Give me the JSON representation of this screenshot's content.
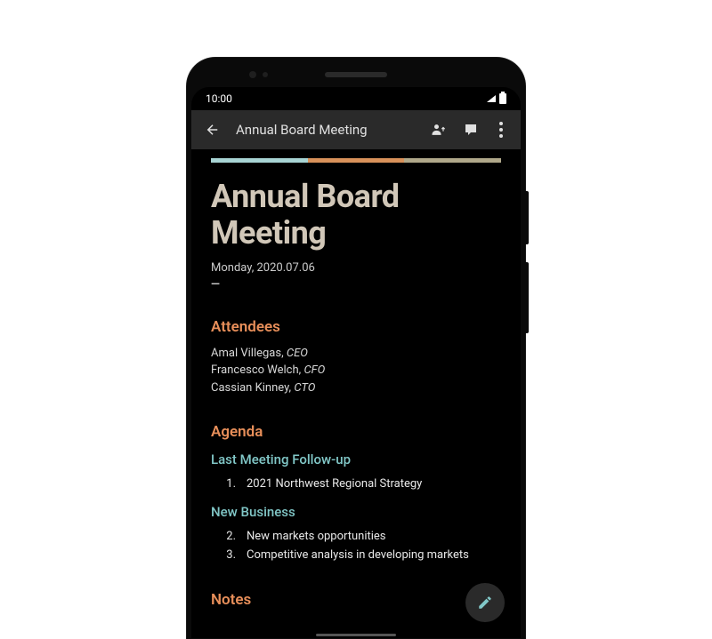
{
  "status_bar": {
    "time": "10:00"
  },
  "app_bar": {
    "title": "Annual Board Meeting"
  },
  "accent_colors": {
    "bar1": "#a8d4d4",
    "bar2": "#d8915a",
    "bar3": "#b0a88a"
  },
  "document": {
    "title": "Annual Board Meeting",
    "date": "Monday, 2020.07.06",
    "dash": "—"
  },
  "sections": {
    "attendees_header": "Attendees",
    "attendees": [
      {
        "name": "Amal Villegas",
        "title": "CEO"
      },
      {
        "name": "Francesco Welch",
        "title": "CFO"
      },
      {
        "name": "Cassian Kinney",
        "title": "CTO"
      }
    ],
    "agenda_header": "Agenda",
    "agenda_groups": [
      {
        "subheader": "Last Meeting Follow-up",
        "items": [
          {
            "num": "1.",
            "text": "2021 Northwest Regional Strategy"
          }
        ]
      },
      {
        "subheader": "New Business",
        "items": [
          {
            "num": "2.",
            "text": "New markets opportunities"
          },
          {
            "num": "3.",
            "text": "Competitive analysis in developing markets"
          }
        ]
      }
    ],
    "notes_header": "Notes"
  }
}
